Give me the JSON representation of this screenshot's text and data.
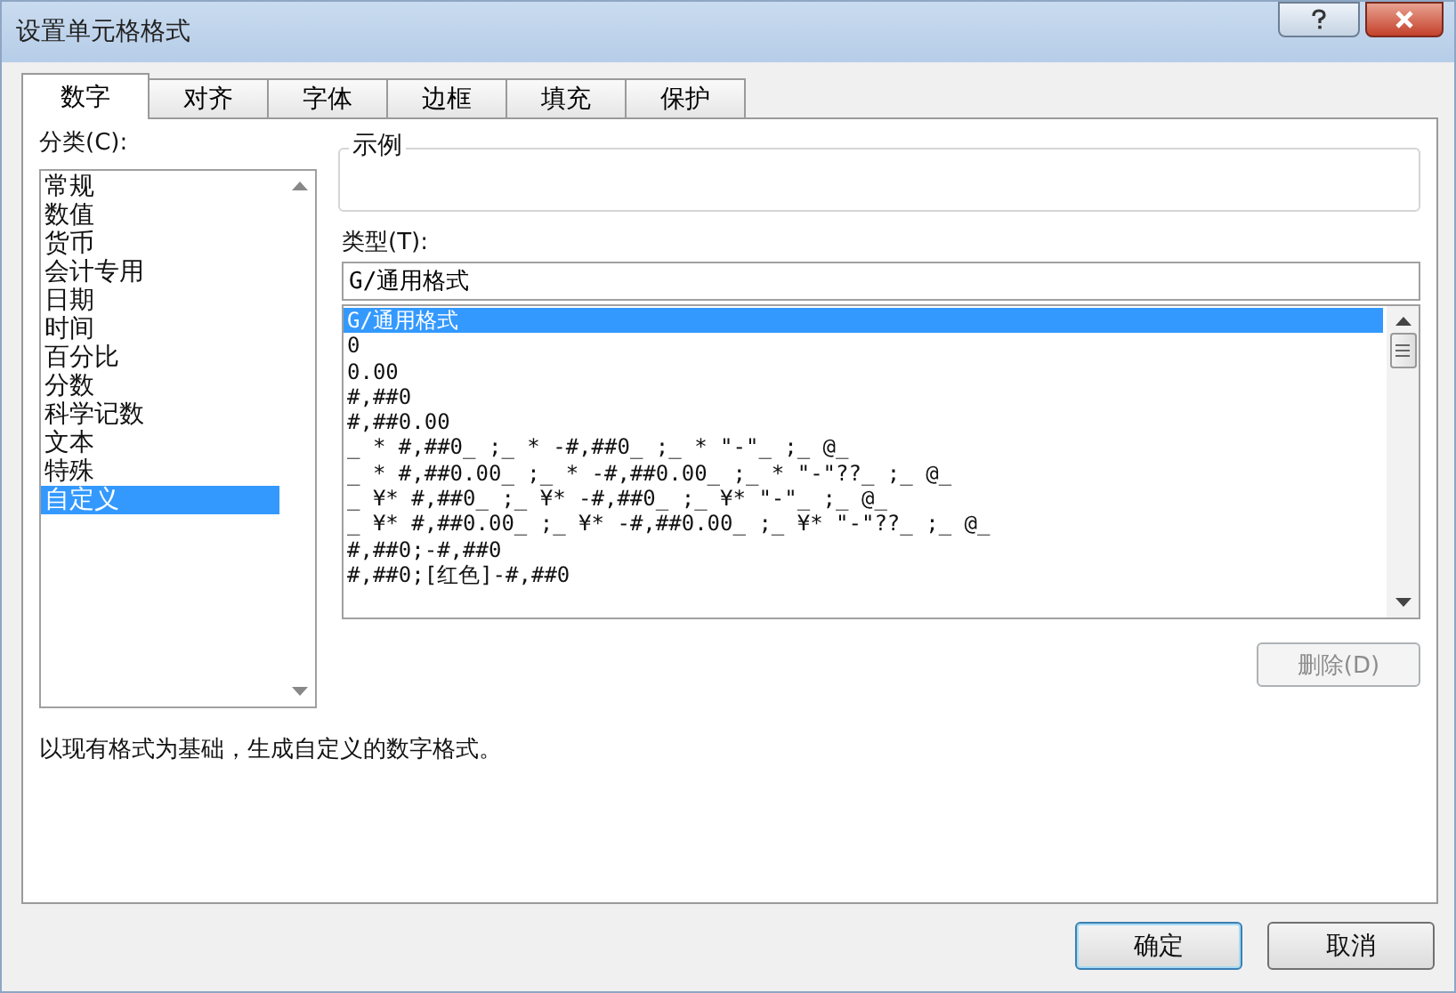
{
  "window": {
    "title": "设置单元格格式"
  },
  "tabs": [
    {
      "label": "数字",
      "selected": true
    },
    {
      "label": "对齐",
      "selected": false
    },
    {
      "label": "字体",
      "selected": false
    },
    {
      "label": "边框",
      "selected": false
    },
    {
      "label": "填充",
      "selected": false
    },
    {
      "label": "保护",
      "selected": false
    }
  ],
  "category": {
    "label": "分类(C):",
    "items": [
      {
        "label": "常规",
        "selected": false
      },
      {
        "label": "数值",
        "selected": false
      },
      {
        "label": "货币",
        "selected": false
      },
      {
        "label": "会计专用",
        "selected": false
      },
      {
        "label": "日期",
        "selected": false
      },
      {
        "label": "时间",
        "selected": false
      },
      {
        "label": "百分比",
        "selected": false
      },
      {
        "label": "分数",
        "selected": false
      },
      {
        "label": "科学记数",
        "selected": false
      },
      {
        "label": "文本",
        "selected": false
      },
      {
        "label": "特殊",
        "selected": false
      },
      {
        "label": "自定义",
        "selected": true
      }
    ]
  },
  "sample": {
    "label": "示例"
  },
  "type": {
    "label": "类型(T):",
    "value": "G/通用格式",
    "items": [
      {
        "label": "G/通用格式",
        "selected": true
      },
      {
        "label": "0",
        "selected": false
      },
      {
        "label": "0.00",
        "selected": false
      },
      {
        "label": "#,##0",
        "selected": false
      },
      {
        "label": "#,##0.00",
        "selected": false
      },
      {
        "label": "_ * #,##0_ ;_ * -#,##0_ ;_ * \"-\"_ ;_ @_",
        "selected": false
      },
      {
        "label": "_ * #,##0.00_ ;_ * -#,##0.00_ ;_ * \"-\"??_ ;_ @_",
        "selected": false
      },
      {
        "label": "_ ¥* #,##0_ ;_ ¥* -#,##0_ ;_ ¥* \"-\"_ ;_ @_",
        "selected": false
      },
      {
        "label": "_ ¥* #,##0.00_ ;_ ¥* -#,##0.00_ ;_ ¥* \"-\"??_ ;_ @_",
        "selected": false
      },
      {
        "label": "#,##0;-#,##0",
        "selected": false
      },
      {
        "label": "#,##0;[红色]-#,##0",
        "selected": false
      }
    ]
  },
  "delete_button": {
    "label": "删除(D)",
    "disabled": true
  },
  "description": "以现有格式为基础，生成自定义的数字格式。",
  "buttons": [
    {
      "label": "确定",
      "kind": "default"
    },
    {
      "label": "取消",
      "kind": "normal"
    }
  ]
}
